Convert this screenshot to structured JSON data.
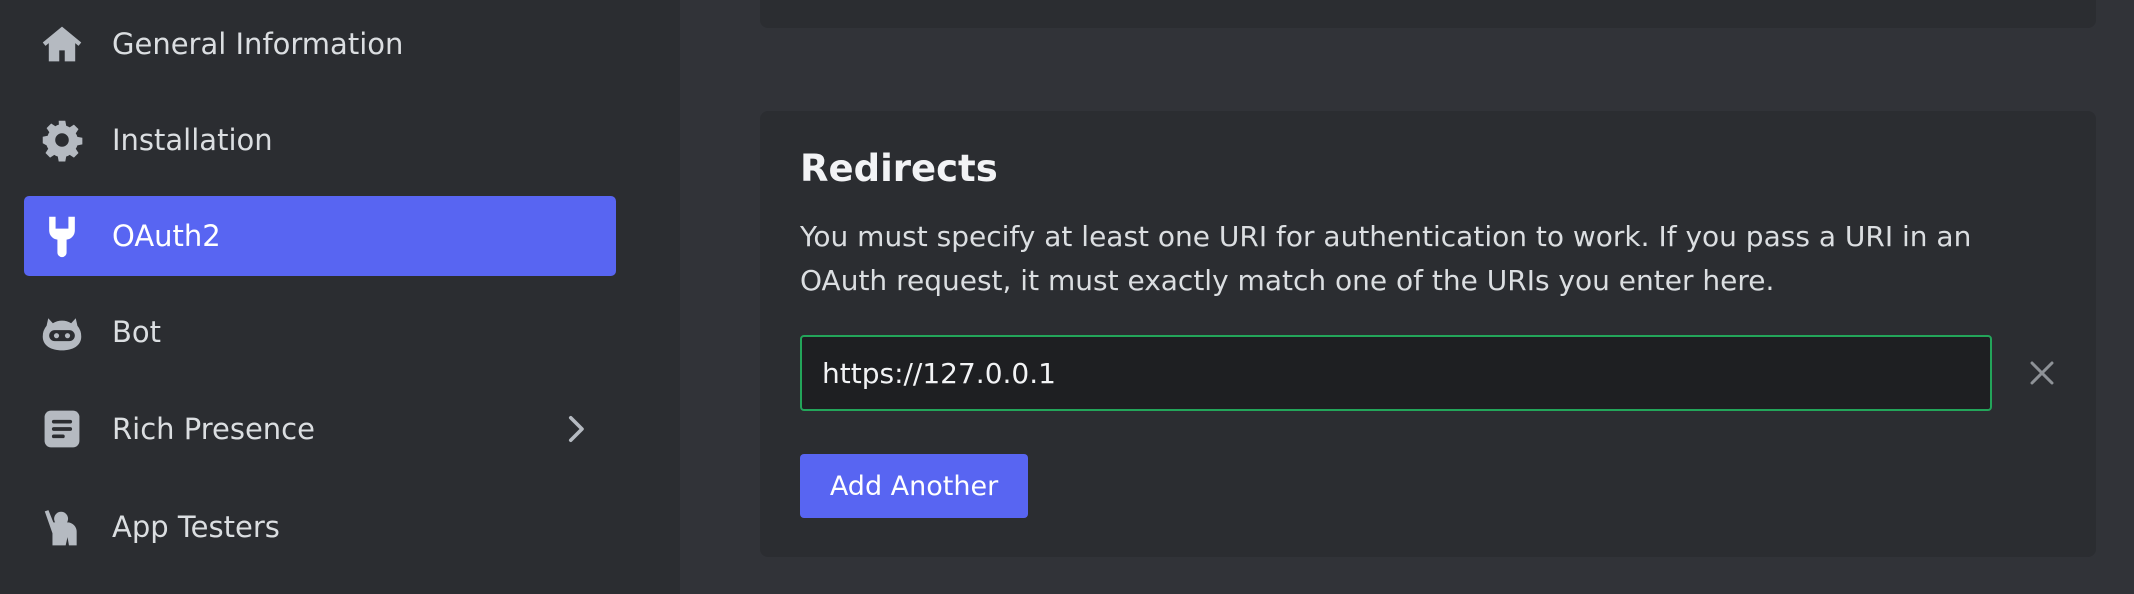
{
  "sidebar": {
    "items": [
      {
        "label": "General Information",
        "icon": "home-icon"
      },
      {
        "label": "Installation",
        "icon": "gear-icon"
      },
      {
        "label": "OAuth2",
        "icon": "wrench-icon",
        "active": true
      },
      {
        "label": "Bot",
        "icon": "bot-icon"
      },
      {
        "label": "Rich Presence",
        "icon": "document-icon",
        "expandable": true
      },
      {
        "label": "App Testers",
        "icon": "tester-icon"
      }
    ]
  },
  "redirects": {
    "title": "Redirects",
    "description": "You must specify at least one URI for authentication to work. If you pass a URI in an OAuth request, it must exactly match one of the URIs you enter here.",
    "uris": [
      "https://127.0.0.1"
    ],
    "add_label": "Add Another",
    "remove_icon": "close-icon"
  },
  "colors": {
    "accent": "#5865f2",
    "sidebar_bg": "#2b2d31",
    "page_bg": "#313338",
    "input_border_valid": "#23a55a"
  }
}
